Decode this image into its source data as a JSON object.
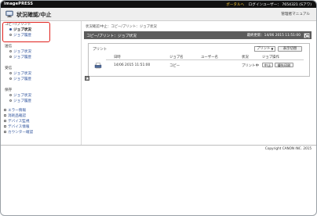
{
  "topbar": {
    "brand": "imagePRESS",
    "portal_link": "ポータルへ",
    "login_user": "ログインユーザー： 7654321 (Sアワ)"
  },
  "header": {
    "title": "状況確認/中止",
    "manual_link": "管理者マニュアル"
  },
  "sidebar": {
    "groups": [
      {
        "label": "コピー/プリント",
        "items": [
          {
            "label": "ジョブ状況",
            "current": true
          },
          {
            "label": "ジョブ履歴",
            "current": false
          }
        ]
      },
      {
        "label": "送信",
        "items": [
          {
            "label": "ジョブ状況"
          },
          {
            "label": "ジョブ履歴"
          }
        ]
      },
      {
        "label": "受信",
        "items": [
          {
            "label": "ジョブ状況"
          },
          {
            "label": "ジョブ履歴"
          }
        ]
      },
      {
        "label": "保存",
        "items": [
          {
            "label": "ジョブ状況"
          },
          {
            "label": "ジョブ履歴"
          }
        ]
      }
    ],
    "top_items": [
      {
        "label": "エラー情報"
      },
      {
        "label": "消耗品確認"
      },
      {
        "label": "デバイス監視"
      },
      {
        "label": "デバイス情報"
      },
      {
        "label": "カウンター確認"
      }
    ]
  },
  "main": {
    "breadcrumb": "状況確認/中止：コピー/プリント：ジョブ状況",
    "section_title": "コピー/プリント：ジョブ状況",
    "last_update": "最終更新：14/06 2015 11:51:00",
    "panel": {
      "label": "プリント",
      "filter_value": "プリント",
      "switch_button": "表示切替",
      "columns": [
        "日時",
        "ジョブ名",
        "ユーザー名",
        "状況",
        "ジョブ操作"
      ],
      "rows": [
        {
          "datetime": "14/06 2015 11:51:00",
          "job_name": "コピー",
          "user_name": "",
          "status": "プリント中",
          "actions": [
            "中止",
            "優先印刷"
          ]
        }
      ]
    }
  },
  "footer": {
    "copyright": "Copyright CANON INC. 2015"
  }
}
